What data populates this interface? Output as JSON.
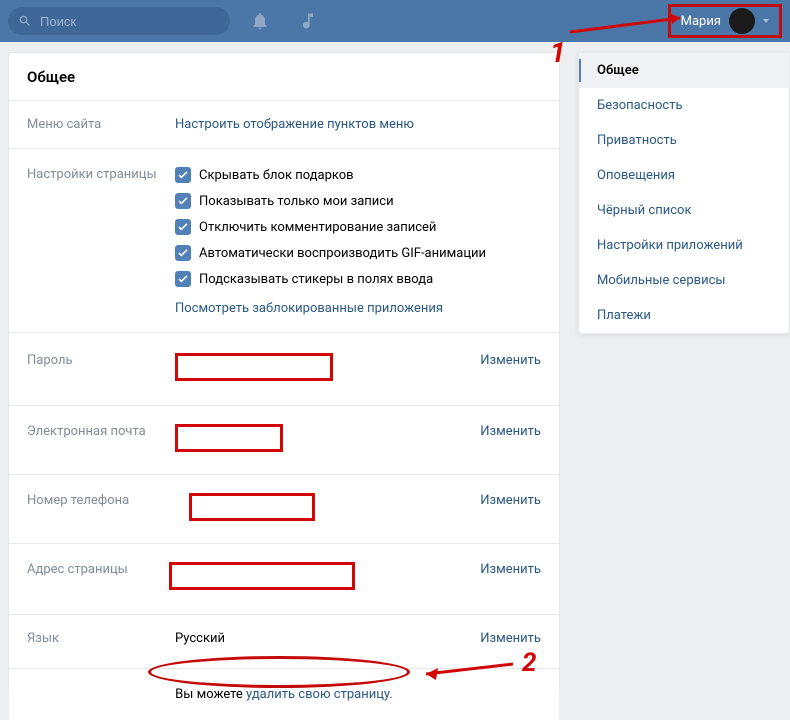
{
  "header": {
    "search_placeholder": "Поиск",
    "user_name": "Мария"
  },
  "main": {
    "title": "Общее",
    "menu": {
      "label": "Меню сайта",
      "link": "Настроить отображение пунктов меню"
    },
    "page_settings": {
      "label": "Настройки страницы",
      "checks": [
        "Скрывать блок подарков",
        "Показывать только мои записи",
        "Отключить комментирование записей",
        "Автоматически воспроизводить GIF-анимации",
        "Подсказывать стикеры в полях ввода"
      ],
      "blocked_link": "Посмотреть заблокированные приложения"
    },
    "password": {
      "label": "Пароль",
      "change": "Изменить"
    },
    "email": {
      "label": "Электронная почта",
      "change": "Изменить"
    },
    "phone": {
      "label": "Номер телефона",
      "change": "Изменить"
    },
    "address": {
      "label": "Адрес страницы",
      "change": "Изменить"
    },
    "language": {
      "label": "Язык",
      "value": "Русский",
      "change": "Изменить"
    },
    "footer": {
      "prefix": "Вы можете ",
      "link": "удалить свою страницу."
    }
  },
  "sidebar": {
    "items": [
      "Общее",
      "Безопасность",
      "Приватность",
      "Оповещения",
      "Чёрный список",
      "Настройки приложений",
      "Мобильные сервисы",
      "Платежи"
    ]
  },
  "annotations": {
    "one": "1",
    "two": "2"
  }
}
